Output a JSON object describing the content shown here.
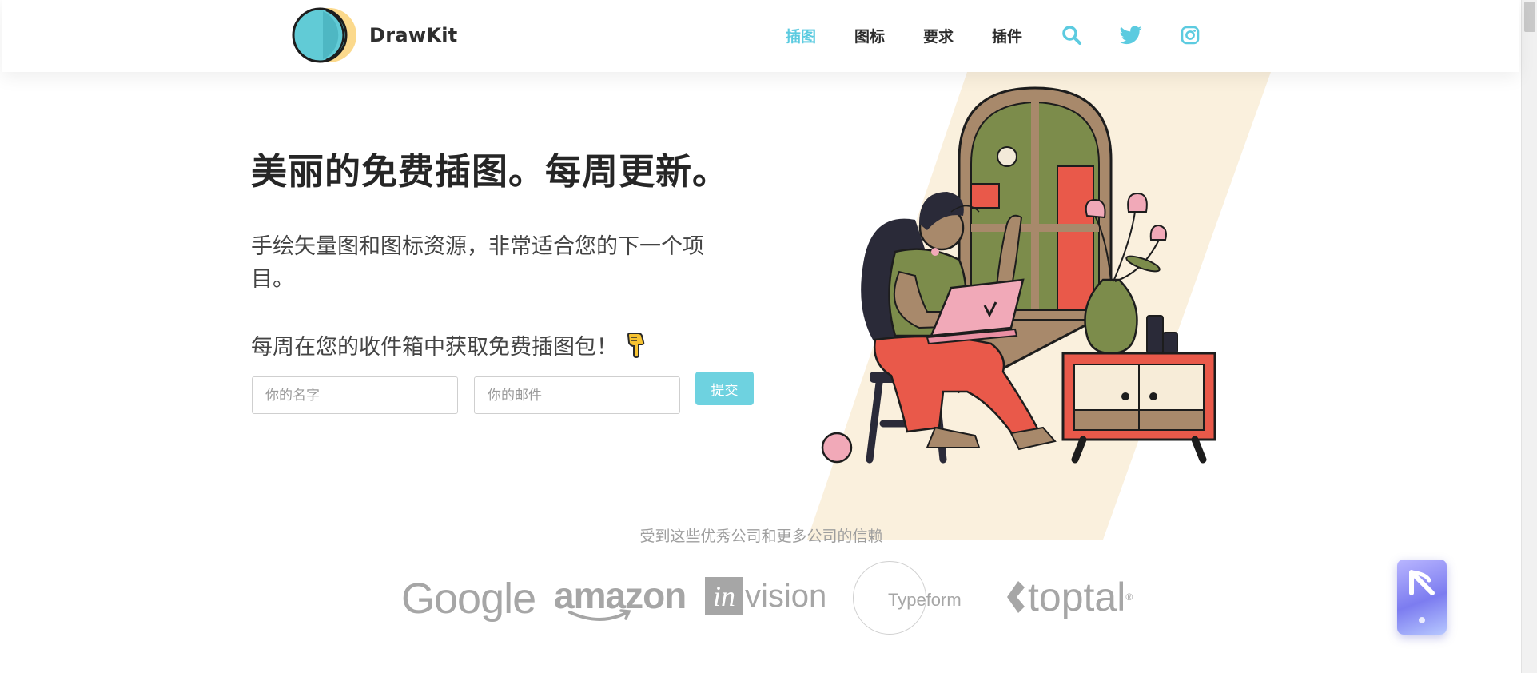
{
  "brand": {
    "name": "DrawKit"
  },
  "nav": {
    "items": [
      {
        "label": "插图",
        "active": true
      },
      {
        "label": "图标",
        "active": false
      },
      {
        "label": "要求",
        "active": false
      },
      {
        "label": "插件",
        "active": false
      }
    ],
    "icons": [
      "search-icon",
      "twitter-icon",
      "instagram-icon"
    ],
    "accent": "#5ccbe0"
  },
  "hero": {
    "title": "美丽的免费插图。每周更新。",
    "subtitle": "手绘矢量图和图标资源，非常适合您的下一个项目。",
    "cta": "每周在您的收件箱中获取免费插图包！"
  },
  "form": {
    "name_placeholder": "你的名字",
    "email_placeholder": "你的邮件",
    "submit_label": "提交",
    "submit_color": "#6ed2e0"
  },
  "trusted": {
    "heading": "受到这些优秀公司和更多公司的信赖",
    "logos": [
      "Google",
      "amazon",
      "in",
      "vision",
      "Typeform",
      "toptal",
      "®"
    ]
  }
}
